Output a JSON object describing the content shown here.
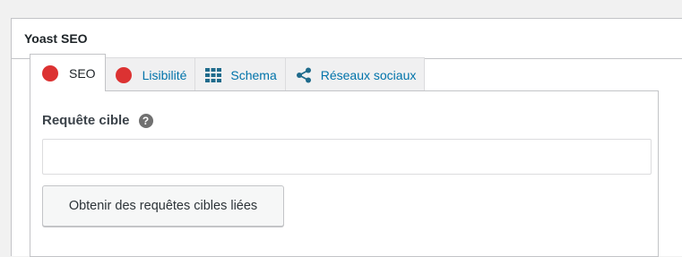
{
  "metabox": {
    "title": "Yoast SEO"
  },
  "tabs": [
    {
      "label": "SEO",
      "icon": "red-dot-icon",
      "active": true
    },
    {
      "label": "Lisibilité",
      "icon": "red-dot-icon",
      "active": false
    },
    {
      "label": "Schema",
      "icon": "grid-icon",
      "active": false
    },
    {
      "label": "Réseaux sociaux",
      "icon": "share-icon",
      "active": false
    }
  ],
  "focus_keyphrase": {
    "label": "Requête cible",
    "help_icon": "question-mark-icon",
    "value": "",
    "placeholder": ""
  },
  "related_button": {
    "label": "Obtenir des requêtes cibles liées"
  },
  "colors": {
    "status_red": "#dc3232",
    "link_blue": "#0073aa",
    "icon_blue": "#1f6b8c"
  }
}
